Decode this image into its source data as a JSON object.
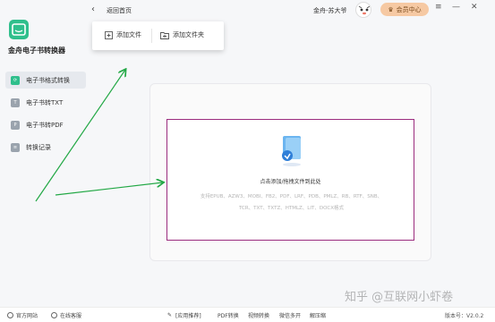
{
  "app": {
    "title": "金舟电子书转换器"
  },
  "sidebar": {
    "items": [
      {
        "label": "电子书格式转换",
        "icon": "convert-icon",
        "active": true
      },
      {
        "label": "电子书转TXT",
        "icon": "txt-icon",
        "active": false
      },
      {
        "label": "电子书转PDF",
        "icon": "pdf-icon",
        "active": false
      },
      {
        "label": "转换记录",
        "icon": "history-icon",
        "active": false
      }
    ]
  },
  "topbar": {
    "back_label": "返回首页",
    "user_name": "金舟-苏大爷",
    "vip_label": "会员中心",
    "menu_icon": "≡",
    "minimize_icon": "—",
    "close_icon": "✕"
  },
  "dropdown": {
    "add_file": "添加文件",
    "add_folder": "添加文件夹"
  },
  "dropzone": {
    "hint": "点击添加/拖拽文件到此处",
    "formats_line1": "支持EPUB、AZW3、MOBI、FB2、PDF、LRF、PDB、PMLZ、RB、RTF、SNB、",
    "formats_line2": "TCR、TXT、TXTZ、HTMLZ、LIT、DOCX格式"
  },
  "bottombar": {
    "website": "官方网站",
    "service": "在线客服",
    "recommend": "[应用推荐]",
    "pdf_convert": "PDF转换",
    "video_convert": "视频转换",
    "wechat_backup": "微信多开",
    "unzip": "解压缩",
    "version": "版本号：V2.0.2"
  },
  "watermark": "知乎 @互联网小虾卷",
  "colors": {
    "accent": "#2fbf8c",
    "dropzone_border": "#9b2c7e",
    "vip_bg": "#f6c9a3",
    "arrow": "#22a845"
  }
}
